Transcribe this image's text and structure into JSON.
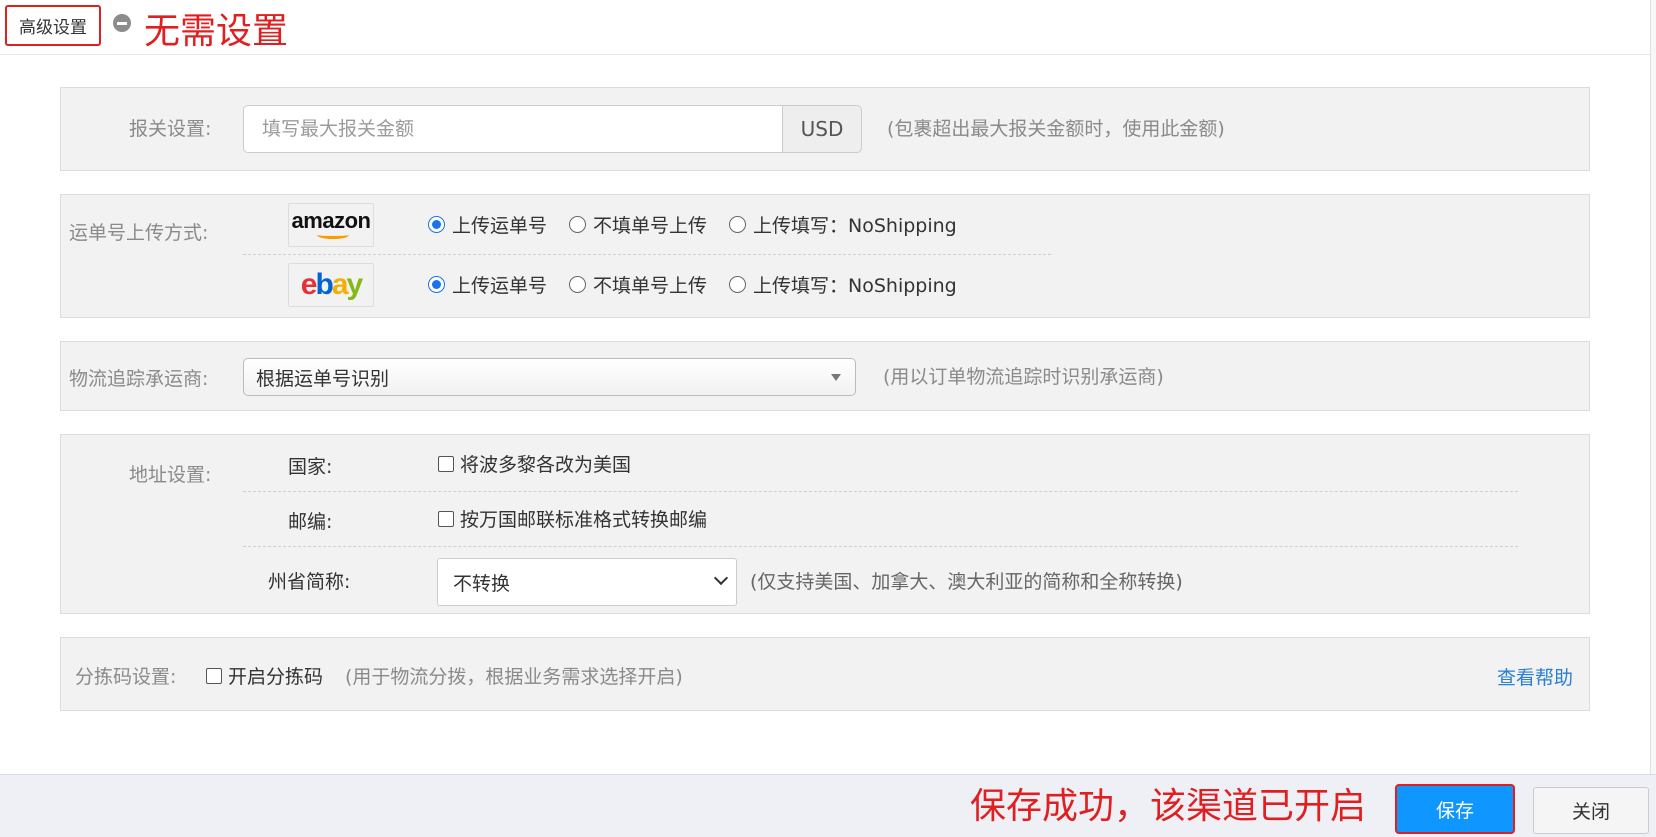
{
  "header": {
    "advanced_button": "高级设置",
    "collapse_icon": "minus-circle-icon",
    "annotation": "无需设置"
  },
  "customs": {
    "label": "报关设置:",
    "placeholder": "填写最大报关金额",
    "value": "",
    "currency": "USD",
    "hint": "(包裹超出最大报关金额时，使用此金额)"
  },
  "upload": {
    "label": "运单号上传方式:",
    "platforms": [
      {
        "logo": "amazon",
        "options": [
          {
            "label": "上传运单号",
            "checked": true
          },
          {
            "label": "不填单号上传",
            "checked": false
          },
          {
            "label": "上传填写：NoShipping",
            "checked": false
          }
        ]
      },
      {
        "logo": "ebay",
        "options": [
          {
            "label": "上传运单号",
            "checked": true
          },
          {
            "label": "不填单号上传",
            "checked": false
          },
          {
            "label": "上传填写：NoShipping",
            "checked": false
          }
        ]
      }
    ]
  },
  "tracking": {
    "label": "物流追踪承运商:",
    "selected": "根据运单号识别",
    "hint": "(用以订单物流追踪时识别承运商)"
  },
  "address": {
    "label": "地址设置:",
    "country_label": "国家:",
    "country_option": "将波多黎各改为美国",
    "country_checked": false,
    "zip_label": "邮编:",
    "zip_option": "按万国邮联标准格式转换邮编",
    "zip_checked": false,
    "state_label": "州省简称:",
    "state_selected": "不转换",
    "state_hint": "(仅支持美国、加拿大、澳大利亚的简称和全称转换)"
  },
  "sorting": {
    "label": "分拣码设置:",
    "option": "开启分拣码",
    "checked": false,
    "hint": "(用于物流分拨，根据业务需求选择开启)",
    "help": "查看帮助"
  },
  "footer": {
    "annotation": "保存成功，该渠道已开启",
    "save": "保存",
    "close": "关闭"
  },
  "colors": {
    "accent_blue": "#0f97ff",
    "annotation_red": "#e02020",
    "link_blue": "#2a7fd4",
    "panel_bg": "#f2f2f2"
  }
}
